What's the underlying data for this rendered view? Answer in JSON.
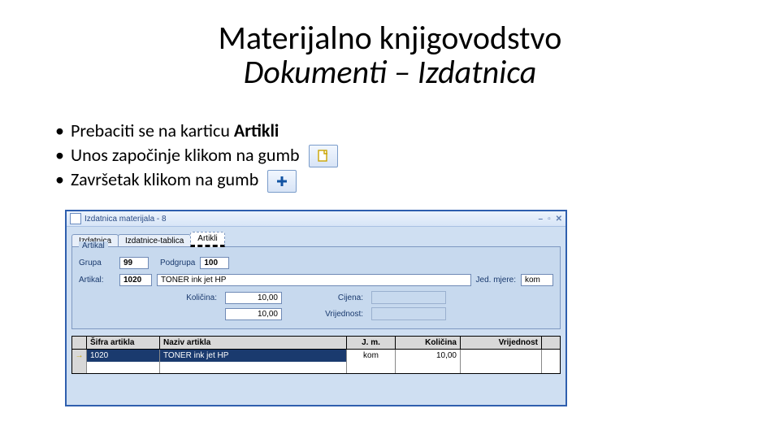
{
  "title": {
    "line1": "Materijalno knjigovodstvo",
    "line2": "Dokumenti – Izdatnica"
  },
  "bullets": {
    "b1a": "Prebaciti se na karticu ",
    "b1b": "Artikli",
    "b2": "Unos započinje klikom na gumb",
    "b3": "Završetak klikom na gumb"
  },
  "icons": {
    "new_doc": "new-doc-icon",
    "plus": "plus-icon"
  },
  "window": {
    "title": "Izdatnica materijala - 8",
    "controls": {
      "min": "–",
      "restore": "▫",
      "close": "✕"
    },
    "tabs": {
      "t1": "Izdatnica",
      "t2": "Izdatnice-tablica",
      "t3": "Artikli"
    },
    "group": "Artikal",
    "labels": {
      "grupa": "Grupa",
      "podgrupa": "Podgrupa",
      "artikal": "Artikal:",
      "jed_mjere": "Jed. mjere:",
      "kolicina": "Količina:",
      "cijena": "Cijena:",
      "vrijednost": "Vrijednost:"
    },
    "values": {
      "grupa": "99",
      "podgrupa": "100",
      "artikal_sifra": "1020",
      "artikal_naziv": "TONER ink jet HP",
      "jed_mjere": "kom",
      "kolicina1": "10,00",
      "kolicina2": "10,00",
      "cijena": "",
      "vrijednost": ""
    },
    "grid": {
      "headers": {
        "h1": "Šifra artikla",
        "h2": "Naziv artikla",
        "h3": "J. m.",
        "h4": "Količina",
        "h5": "Vrijednost"
      },
      "row": {
        "marker": "→",
        "sifra": "1020",
        "naziv": "TONER ink jet HP",
        "jm": "kom",
        "kol": "10,00",
        "vr": ""
      }
    }
  }
}
